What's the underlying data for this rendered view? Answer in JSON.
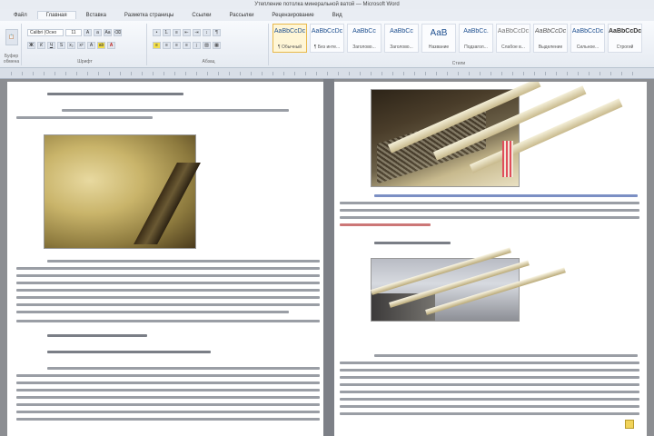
{
  "window": {
    "title": "Утепление потолка минеральной ватой — Microsoft Word"
  },
  "ribbon": {
    "tabs": [
      "Файл",
      "Главная",
      "Вставка",
      "Разметка страницы",
      "Ссылки",
      "Рассылки",
      "Рецензирование",
      "Вид"
    ],
    "active_tab": "Главная",
    "groups": {
      "clipboard": "Буфер обмена",
      "font": "Шрифт",
      "paragraph": "Абзац",
      "styles": "Стили"
    },
    "font_name": "Calibri (Осно",
    "font_size": "11",
    "styles": [
      {
        "sample": "AaBbCcDc",
        "name": "¶ Обычный"
      },
      {
        "sample": "AaBbCcDc",
        "name": "¶ Без инте..."
      },
      {
        "sample": "AaBbCc",
        "name": "Заголово..."
      },
      {
        "sample": "AaBbCc",
        "name": "Заголово..."
      },
      {
        "sample": "AaB",
        "name": "Название"
      },
      {
        "sample": "AaBbCc.",
        "name": "Подзагол..."
      },
      {
        "sample": "AaBbCcDc",
        "name": "Слабое в..."
      },
      {
        "sample": "AaBbCcDc",
        "name": "Выделение"
      },
      {
        "sample": "AaBbCcDc",
        "name": "Сильное..."
      },
      {
        "sample": "AaBbCcDc",
        "name": "Строгий"
      }
    ]
  }
}
